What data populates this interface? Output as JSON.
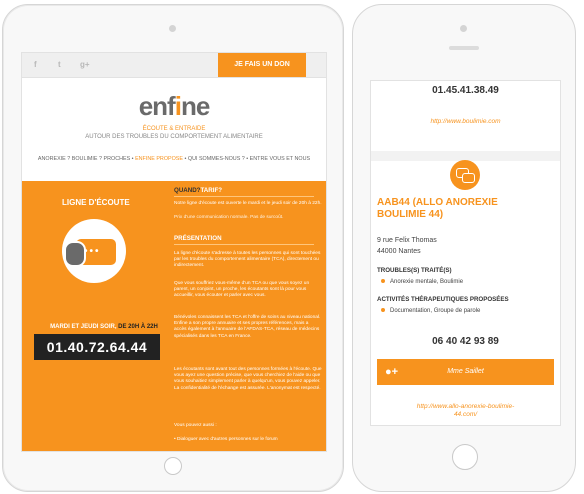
{
  "tablet": {
    "donate_label": "JE FAIS UN DON",
    "social": {
      "facebook": "f",
      "twitter": "t",
      "google": "g+"
    },
    "logo_left": "enf",
    "logo_i": "i",
    "logo_right": "ne",
    "tagline_1": "ÉCOUTE & ENTRAIDE",
    "tagline_2": "AUTOUR DES TROUBLES DU COMPORTEMENT ALIMENTAIRE",
    "nav": {
      "item1": "ANOREXIE ? BOULIMIE ? PROCHES •",
      "item2": "ENFINE PROPOSE",
      "item3": "• QUI SOMMES-NOUS ? • ENTRE VOUS ET NOUS"
    },
    "panel_title": "LIGNE D'ÉCOUTE",
    "hours_white": "MARDI ET JEUDI SOIR,",
    "hours_dark": "DE 20H À 22H",
    "phone_number": "01.40.72.64.44",
    "right": {
      "head1_a": "QUAND?",
      "head1_b": "TARIF?",
      "p1": "Notre ligne d'écoute est ouverte le mardi et le jeudi soir de 20h à 22h.",
      "p1b": "Prix d'une communication normale. Pas de surcoût.",
      "head2": "PRÉSENTATION",
      "p2": "La ligne d'écoute s'adresse à toutes les personnes qui sont touchées par les troubles du comportement alimentaire (TCA), directement ou indirectement.",
      "p3": "Que vous souffriez vous-même d'un TCA ou que vous soyez un parent, un conjoint, un proche, les écoutants sont là pour vous accueillir, vous écouter et parler avec vous.",
      "p4": "Bénévoles connaissent les TCA et l'offre de soins au niveau national. Enfine a son propre annuaire et ses propres références, mais a accès également à l'annuaire de l'AFDAS-TCA, réseau de médecins spécialisés dans les TCA en France.",
      "p5": "Les écoutants sont avant tout des personnes formées à l'écoute. Que vous ayez une question précise, que vous cherchiez de l'aide ou que vous souhaitiez simplement parler à quelqu'un, vous pouvez appeler. La confidentialité de l'échange est assurée. L'anonymat est respecté.",
      "p6": "Vous pouvez aussi :",
      "p7": "• Dialoguer avec d'autres personnes sur le forum"
    }
  },
  "phone": {
    "number_top": "01.45.41.38.49",
    "link_top": "http://www.boulimie.com",
    "title": "AAB44 (ALLO ANOREXIE BOULIMIE 44)",
    "address_1": "9 rue Felix Thomas",
    "address_2": "44000 Nantes",
    "troubles_heading": "TROUBLES(S) TRAITÉ(S)",
    "troubles": [
      "Anorexie mentale, Boulimie"
    ],
    "activities_heading": "ACTIVITÉS THÉRAPEUTIQUES PROPOSÉES",
    "activities": [
      "Documentation, Groupe de parole"
    ],
    "number": "06 40 42 93 89",
    "contact_label": "Mme Saillet",
    "link_bottom_1": "http://www.allo-anorexie-boulimie-",
    "link_bottom_2": "44.com/"
  },
  "colors": {
    "accent": "#f7931e",
    "dark": "#222222",
    "grey": "#6a6a6a"
  }
}
